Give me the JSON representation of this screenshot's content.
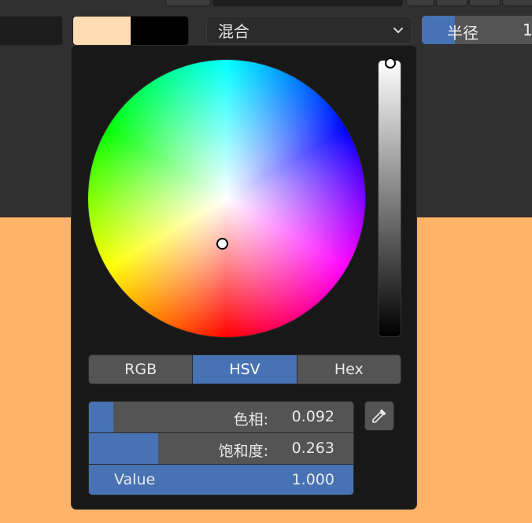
{
  "header": {
    "blend_mode": "混合",
    "radius_label": "半径",
    "radius_value": "1",
    "primary_color": "#ffdcb4",
    "secondary_color": "#000000"
  },
  "picker": {
    "tabs": [
      {
        "label": "RGB",
        "active": false
      },
      {
        "label": "HSV",
        "active": true
      },
      {
        "label": "Hex",
        "active": false
      }
    ],
    "sliders": {
      "hue": {
        "label": "色相:",
        "value": "0.092",
        "fraction": 0.092
      },
      "saturation": {
        "label": "饱和度:",
        "value": "0.263",
        "fraction": 0.263
      },
      "value": {
        "label": "Value",
        "value": "1.000",
        "fraction": 1.0
      }
    },
    "icons": {
      "eyedropper": "eyedropper-icon",
      "dropdown": "chevron-down-icon"
    }
  },
  "colors": {
    "accent": "#4772b3",
    "canvas": "#ffb368",
    "widget": "#545454",
    "panel": "#181818"
  }
}
